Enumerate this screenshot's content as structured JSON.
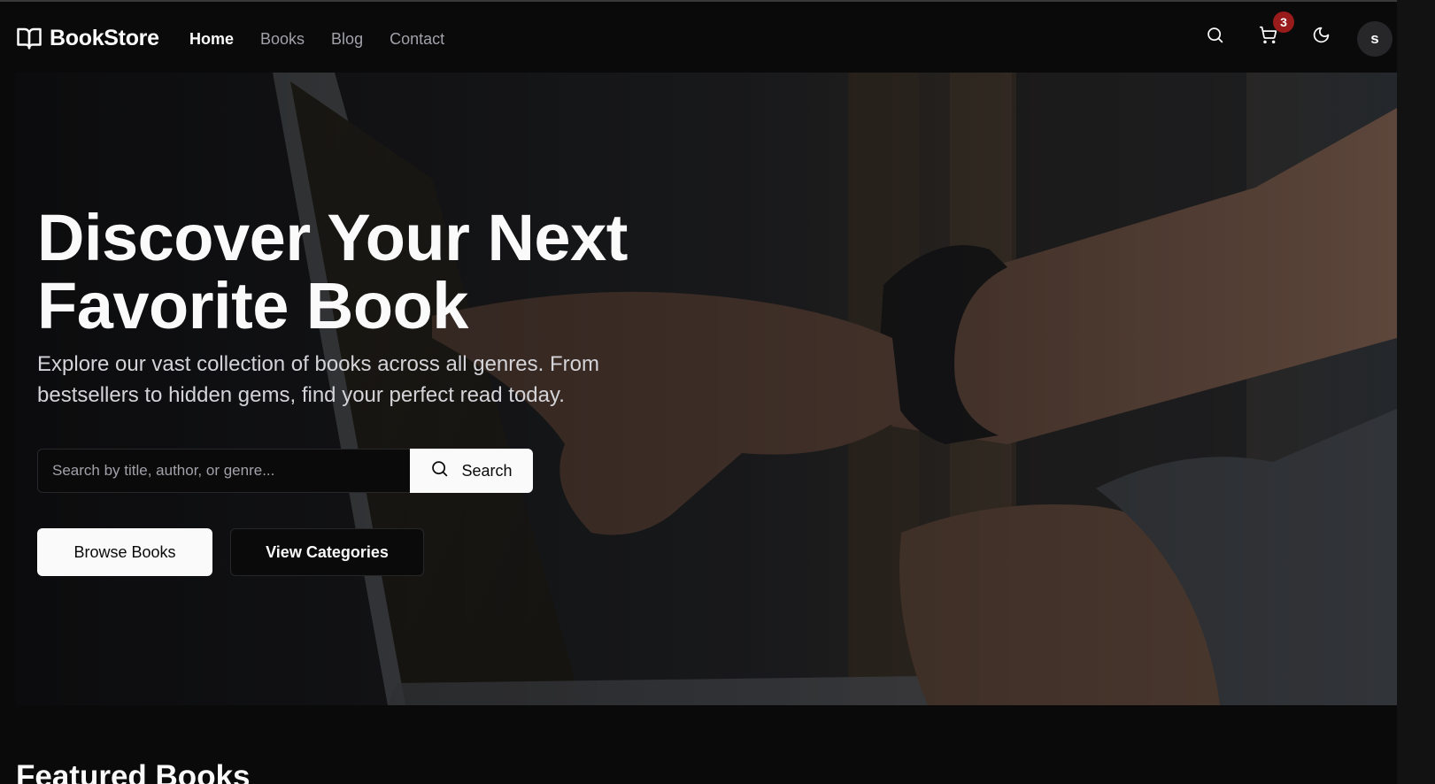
{
  "brand": {
    "name": "BookStore",
    "icon": "open-book-icon"
  },
  "nav": {
    "links": [
      {
        "label": "Home",
        "active": true
      },
      {
        "label": "Books",
        "active": false
      },
      {
        "label": "Blog",
        "active": false
      },
      {
        "label": "Contact",
        "active": false
      }
    ]
  },
  "header_actions": {
    "search_icon": "search-icon",
    "cart_icon": "cart-icon",
    "cart_count": "3",
    "theme_icon": "moon-icon",
    "avatar_initial": "s"
  },
  "hero": {
    "title_line1": "Discover Your Next",
    "title_line2": "Favorite Book",
    "subtitle": "Explore our vast collection of books across all genres. From bestsellers to hidden gems, find your perfect read today.",
    "search": {
      "placeholder": "Search by title, author, or genre...",
      "value": "",
      "button_label": "Search"
    },
    "primary_cta": "Browse Books",
    "secondary_cta": "View Categories"
  },
  "featured": {
    "title": "Featured Books"
  },
  "colors": {
    "background": "#0a0a0a",
    "foreground": "#fafafa",
    "muted": "#a1a1aa",
    "badge": "#991b1b"
  }
}
